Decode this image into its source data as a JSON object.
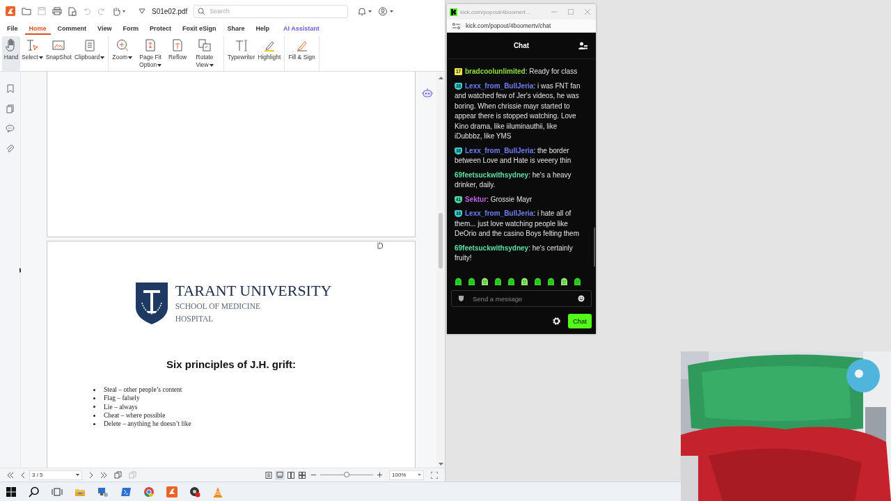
{
  "pdf_window": {
    "file_name": "S01e02.pdf",
    "search": {
      "placeholder": "Search"
    },
    "menu_tabs": [
      {
        "label": "File",
        "selected": false,
        "kind": "menu"
      },
      {
        "label": "Home",
        "selected": true,
        "kind": "menu"
      },
      {
        "label": "Comment",
        "selected": false,
        "kind": "menu"
      },
      {
        "label": "View",
        "selected": false,
        "kind": "menu"
      },
      {
        "label": "Form",
        "selected": false,
        "kind": "menu"
      },
      {
        "label": "Protect",
        "selected": false,
        "kind": "menu"
      },
      {
        "label": "Foxit eSign",
        "selected": false,
        "kind": "menu"
      },
      {
        "label": "Share",
        "selected": false,
        "kind": "menu"
      },
      {
        "label": "Help",
        "selected": false,
        "kind": "menu"
      },
      {
        "label": "AI Assistant",
        "selected": false,
        "kind": "ai"
      }
    ],
    "ribbon_groups": [
      {
        "tools": [
          {
            "label": "Hand",
            "selected": true,
            "dropdown": false
          },
          {
            "label": "Select",
            "selected": false,
            "dropdown": true
          },
          {
            "label": "SnapShot",
            "selected": false,
            "dropdown": false
          },
          {
            "label": "Clipboard",
            "selected": false,
            "dropdown": true
          }
        ]
      },
      {
        "tools": [
          {
            "label": "Zoom",
            "selected": false,
            "dropdown": true
          },
          {
            "label": "Page Fit Option",
            "selected": false,
            "dropdown": true
          },
          {
            "label": "Reflow",
            "selected": false,
            "dropdown": false
          },
          {
            "label": "Rotate View",
            "selected": false,
            "dropdown": true
          }
        ]
      },
      {
        "tools": [
          {
            "label": "Typewriter",
            "selected": false,
            "dropdown": false
          },
          {
            "label": "Highlight",
            "selected": false,
            "dropdown": false
          }
        ]
      },
      {
        "tools": [
          {
            "label": "Fill & Sign",
            "selected": false,
            "dropdown": false
          }
        ]
      }
    ],
    "document": {
      "logo": {
        "title": "TARANT UNIVERSITY",
        "subtitle": "SCHOOL OF MEDICINE",
        "line3": "HOSPITAL"
      },
      "heading": "Six principles of J.H. grift:",
      "bullets": [
        "Steal – other people’s content",
        "Flag – falsely",
        "Lie – always",
        "Cheat – where possible",
        "Delete – anything he doesn’t like"
      ]
    },
    "status_bar": {
      "page": "3 / 5",
      "view_modes": [
        {
          "selected": false
        },
        {
          "selected": true
        },
        {
          "selected": false
        },
        {
          "selected": false
        }
      ],
      "zoom": {
        "level": 0.5,
        "value": "100%"
      }
    }
  },
  "chat_window": {
    "tab_title": "kick.com/popout/4boomert...",
    "url": "kick.com/popout/4boomertv/chat",
    "header": "Chat",
    "messages": [
      {
        "badge": {
          "label": "17",
          "color": "#f0e54a",
          "kind": "square"
        },
        "user": "bradcoolunlimited",
        "color": "#8fe23f",
        "text": ": Ready for class"
      },
      {
        "badge": {
          "label": "38",
          "color": "#3ccfd0",
          "kind": "shield"
        },
        "user": "Lexx_from_BullJeria",
        "color": "#6f7ff2",
        "text": ": i was FNT fan and watched few of Jer's videos, he was boring. When chrissie mayr started to appear there is stopped watching. Love Kino drama, like iiluminauthii, like iDubbbz, like YMS"
      },
      {
        "badge": {
          "label": "38",
          "color": "#3ccfd0",
          "kind": "shield"
        },
        "user": "Lexx_from_BullJeria",
        "color": "#6f7ff2",
        "text": ": the border between Love and Hate is veeery thin"
      },
      {
        "user": "69feetsuckwithsydney",
        "color": "#5fe0a4",
        "text": ": he's a heavy drinker, daily."
      },
      {
        "badge": {
          "label": "41",
          "color": "#4fd6a6",
          "kind": "shield"
        },
        "user": "Sektur",
        "color": "#c45ee6",
        "text": ": Grossie Mayr"
      },
      {
        "badge": {
          "label": "38",
          "color": "#3ccfd0",
          "kind": "shield"
        },
        "user": "Lexx_from_BullJeria",
        "color": "#6f7ff2",
        "text": ": i hate all of them... just love watching people like DeOrio and the casino Boys felting them"
      },
      {
        "user": "69feetsuckwithsydney",
        "color": "#5fe0a4",
        "text": ": he's certainly fruity!"
      }
    ],
    "input": {
      "placeholder": "Send a message"
    },
    "send_button": "Chat"
  }
}
